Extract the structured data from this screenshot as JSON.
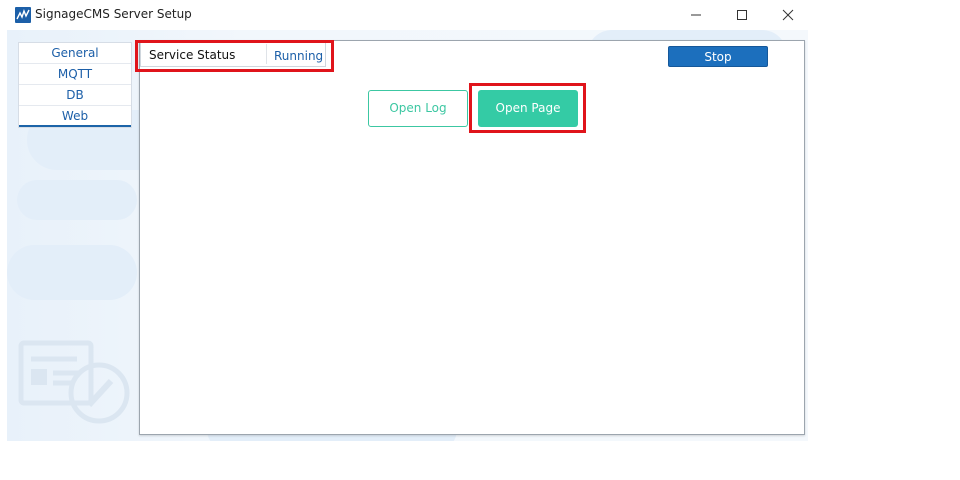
{
  "window": {
    "title": "SignageCMS Server Setup",
    "icon": "signage-app-icon",
    "controls": [
      "minimize-icon",
      "maximize-icon",
      "close-icon"
    ]
  },
  "tabs": [
    {
      "label": "General",
      "active": false
    },
    {
      "label": "MQTT",
      "active": false
    },
    {
      "label": "DB",
      "active": false
    },
    {
      "label": "Web",
      "active": true
    }
  ],
  "service": {
    "label": "Service Status",
    "value": "Running"
  },
  "actions": {
    "stop": "Stop",
    "open_log": "Open Log",
    "open_page": "Open Page"
  },
  "colors": {
    "accent_blue": "#1c6fbd",
    "accent_green": "#34cba5",
    "highlight_red": "#e0141b"
  }
}
